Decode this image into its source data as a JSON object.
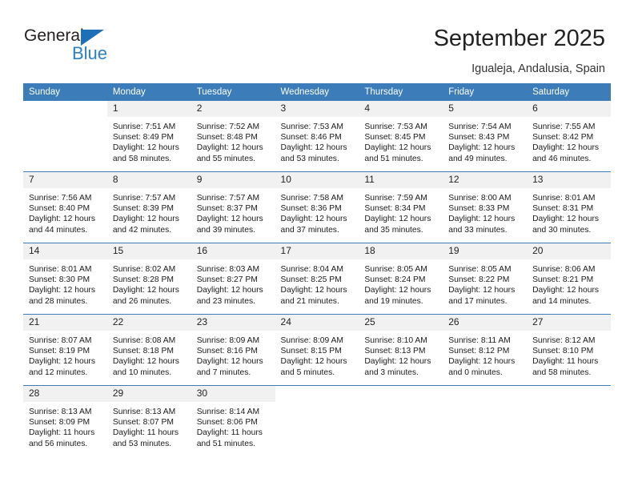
{
  "brand": {
    "name_part1": "General",
    "name_part2": "Blue",
    "triangle_color": "#1d6fb7",
    "blue_color": "#2980c4"
  },
  "header": {
    "title": "September 2025",
    "location": "Igualeja, Andalusia, Spain",
    "header_bg": "#3b7cb9",
    "daynum_bg": "#f1f1f1"
  },
  "weekdays": [
    "Sunday",
    "Monday",
    "Tuesday",
    "Wednesday",
    "Thursday",
    "Friday",
    "Saturday"
  ],
  "labels": {
    "sunrise": "Sunrise:",
    "sunset": "Sunset:",
    "daylight": "Daylight:"
  },
  "weeks": [
    [
      {
        "day": "",
        "blank": true
      },
      {
        "day": "1",
        "sunrise": "Sunrise: 7:51 AM",
        "sunset": "Sunset: 8:49 PM",
        "daylight1": "Daylight: 12 hours",
        "daylight2": "and 58 minutes."
      },
      {
        "day": "2",
        "sunrise": "Sunrise: 7:52 AM",
        "sunset": "Sunset: 8:48 PM",
        "daylight1": "Daylight: 12 hours",
        "daylight2": "and 55 minutes."
      },
      {
        "day": "3",
        "sunrise": "Sunrise: 7:53 AM",
        "sunset": "Sunset: 8:46 PM",
        "daylight1": "Daylight: 12 hours",
        "daylight2": "and 53 minutes."
      },
      {
        "day": "4",
        "sunrise": "Sunrise: 7:53 AM",
        "sunset": "Sunset: 8:45 PM",
        "daylight1": "Daylight: 12 hours",
        "daylight2": "and 51 minutes."
      },
      {
        "day": "5",
        "sunrise": "Sunrise: 7:54 AM",
        "sunset": "Sunset: 8:43 PM",
        "daylight1": "Daylight: 12 hours",
        "daylight2": "and 49 minutes."
      },
      {
        "day": "6",
        "sunrise": "Sunrise: 7:55 AM",
        "sunset": "Sunset: 8:42 PM",
        "daylight1": "Daylight: 12 hours",
        "daylight2": "and 46 minutes."
      }
    ],
    [
      {
        "day": "7",
        "sunrise": "Sunrise: 7:56 AM",
        "sunset": "Sunset: 8:40 PM",
        "daylight1": "Daylight: 12 hours",
        "daylight2": "and 44 minutes."
      },
      {
        "day": "8",
        "sunrise": "Sunrise: 7:57 AM",
        "sunset": "Sunset: 8:39 PM",
        "daylight1": "Daylight: 12 hours",
        "daylight2": "and 42 minutes."
      },
      {
        "day": "9",
        "sunrise": "Sunrise: 7:57 AM",
        "sunset": "Sunset: 8:37 PM",
        "daylight1": "Daylight: 12 hours",
        "daylight2": "and 39 minutes."
      },
      {
        "day": "10",
        "sunrise": "Sunrise: 7:58 AM",
        "sunset": "Sunset: 8:36 PM",
        "daylight1": "Daylight: 12 hours",
        "daylight2": "and 37 minutes."
      },
      {
        "day": "11",
        "sunrise": "Sunrise: 7:59 AM",
        "sunset": "Sunset: 8:34 PM",
        "daylight1": "Daylight: 12 hours",
        "daylight2": "and 35 minutes."
      },
      {
        "day": "12",
        "sunrise": "Sunrise: 8:00 AM",
        "sunset": "Sunset: 8:33 PM",
        "daylight1": "Daylight: 12 hours",
        "daylight2": "and 33 minutes."
      },
      {
        "day": "13",
        "sunrise": "Sunrise: 8:01 AM",
        "sunset": "Sunset: 8:31 PM",
        "daylight1": "Daylight: 12 hours",
        "daylight2": "and 30 minutes."
      }
    ],
    [
      {
        "day": "14",
        "sunrise": "Sunrise: 8:01 AM",
        "sunset": "Sunset: 8:30 PM",
        "daylight1": "Daylight: 12 hours",
        "daylight2": "and 28 minutes."
      },
      {
        "day": "15",
        "sunrise": "Sunrise: 8:02 AM",
        "sunset": "Sunset: 8:28 PM",
        "daylight1": "Daylight: 12 hours",
        "daylight2": "and 26 minutes."
      },
      {
        "day": "16",
        "sunrise": "Sunrise: 8:03 AM",
        "sunset": "Sunset: 8:27 PM",
        "daylight1": "Daylight: 12 hours",
        "daylight2": "and 23 minutes."
      },
      {
        "day": "17",
        "sunrise": "Sunrise: 8:04 AM",
        "sunset": "Sunset: 8:25 PM",
        "daylight1": "Daylight: 12 hours",
        "daylight2": "and 21 minutes."
      },
      {
        "day": "18",
        "sunrise": "Sunrise: 8:05 AM",
        "sunset": "Sunset: 8:24 PM",
        "daylight1": "Daylight: 12 hours",
        "daylight2": "and 19 minutes."
      },
      {
        "day": "19",
        "sunrise": "Sunrise: 8:05 AM",
        "sunset": "Sunset: 8:22 PM",
        "daylight1": "Daylight: 12 hours",
        "daylight2": "and 17 minutes."
      },
      {
        "day": "20",
        "sunrise": "Sunrise: 8:06 AM",
        "sunset": "Sunset: 8:21 PM",
        "daylight1": "Daylight: 12 hours",
        "daylight2": "and 14 minutes."
      }
    ],
    [
      {
        "day": "21",
        "sunrise": "Sunrise: 8:07 AM",
        "sunset": "Sunset: 8:19 PM",
        "daylight1": "Daylight: 12 hours",
        "daylight2": "and 12 minutes."
      },
      {
        "day": "22",
        "sunrise": "Sunrise: 8:08 AM",
        "sunset": "Sunset: 8:18 PM",
        "daylight1": "Daylight: 12 hours",
        "daylight2": "and 10 minutes."
      },
      {
        "day": "23",
        "sunrise": "Sunrise: 8:09 AM",
        "sunset": "Sunset: 8:16 PM",
        "daylight1": "Daylight: 12 hours",
        "daylight2": "and 7 minutes."
      },
      {
        "day": "24",
        "sunrise": "Sunrise: 8:09 AM",
        "sunset": "Sunset: 8:15 PM",
        "daylight1": "Daylight: 12 hours",
        "daylight2": "and 5 minutes."
      },
      {
        "day": "25",
        "sunrise": "Sunrise: 8:10 AM",
        "sunset": "Sunset: 8:13 PM",
        "daylight1": "Daylight: 12 hours",
        "daylight2": "and 3 minutes."
      },
      {
        "day": "26",
        "sunrise": "Sunrise: 8:11 AM",
        "sunset": "Sunset: 8:12 PM",
        "daylight1": "Daylight: 12 hours",
        "daylight2": "and 0 minutes."
      },
      {
        "day": "27",
        "sunrise": "Sunrise: 8:12 AM",
        "sunset": "Sunset: 8:10 PM",
        "daylight1": "Daylight: 11 hours",
        "daylight2": "and 58 minutes."
      }
    ],
    [
      {
        "day": "28",
        "sunrise": "Sunrise: 8:13 AM",
        "sunset": "Sunset: 8:09 PM",
        "daylight1": "Daylight: 11 hours",
        "daylight2": "and 56 minutes."
      },
      {
        "day": "29",
        "sunrise": "Sunrise: 8:13 AM",
        "sunset": "Sunset: 8:07 PM",
        "daylight1": "Daylight: 11 hours",
        "daylight2": "and 53 minutes."
      },
      {
        "day": "30",
        "sunrise": "Sunrise: 8:14 AM",
        "sunset": "Sunset: 8:06 PM",
        "daylight1": "Daylight: 11 hours",
        "daylight2": "and 51 minutes."
      },
      {
        "day": "",
        "blank": true
      },
      {
        "day": "",
        "blank": true
      },
      {
        "day": "",
        "blank": true
      },
      {
        "day": "",
        "blank": true
      }
    ]
  ]
}
